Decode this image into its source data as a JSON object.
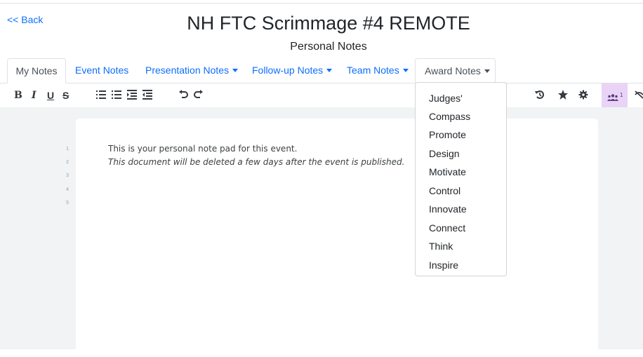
{
  "header": {
    "back": "<< Back",
    "title": "NH FTC Scrimmage #4 REMOTE",
    "subtitle": "Personal Notes"
  },
  "tabs": [
    {
      "label": "My Notes"
    },
    {
      "label": "Event Notes"
    },
    {
      "label": "Presentation Notes"
    },
    {
      "label": "Follow-up Notes"
    },
    {
      "label": "Team Notes"
    },
    {
      "label": "Award Notes"
    }
  ],
  "toolbar": {
    "bold": "B",
    "italic": "I",
    "underline": "U",
    "strike": "S",
    "users_count": "1",
    "icons": [
      "bold-icon",
      "italic-icon",
      "underline-icon",
      "strikethrough-icon",
      "ordered-list-icon",
      "unordered-list-icon",
      "indent-icon",
      "outdent-icon",
      "undo-icon",
      "redo-icon",
      "history-icon",
      "star-icon",
      "gear-icon",
      "users-icon",
      "eye-slash-icon"
    ]
  },
  "editor": {
    "line_numbers": [
      "1",
      "2",
      "3",
      "4",
      "5"
    ],
    "lines": [
      "This is your personal note pad for this event.",
      "This document will be deleted a few days after the event is published."
    ]
  },
  "award_menu": {
    "items": [
      "Judges'",
      "Compass",
      "Promote",
      "Design",
      "Motivate",
      "Control",
      "Innovate",
      "Connect",
      "Think",
      "Inspire"
    ]
  },
  "colors": {
    "link": "#0d6efd",
    "users_highlight": "#e9d3f7",
    "editor_background": "#f1f3f4"
  }
}
